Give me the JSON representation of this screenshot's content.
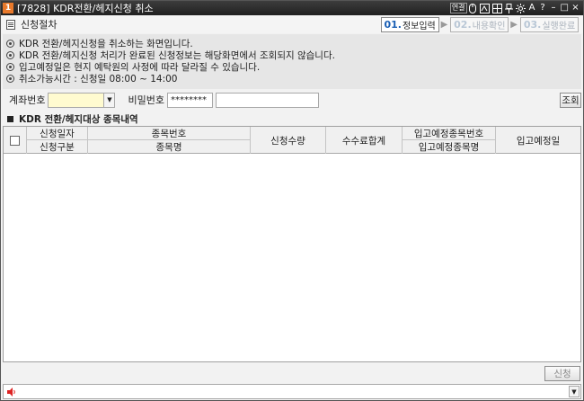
{
  "window": {
    "icon_label": "1",
    "title": "[7828] KDR전환/헤지신청 취소",
    "toolbar_icons": [
      "link-icon",
      "mouse-icon",
      "screenshot-icon",
      "grid-icon",
      "pin-icon",
      "settings-icon",
      "font-icon",
      "help-icon",
      "minimize-icon",
      "maximize-icon",
      "close-icon"
    ],
    "toolbar_labels": {
      "link": "연결",
      "font": "A",
      "help": "?",
      "minimize": "–",
      "maximize": "□",
      "close": "×"
    }
  },
  "steps": {
    "title": "신청절차",
    "items": [
      {
        "num": "01.",
        "label": "정보입력",
        "state": "active"
      },
      {
        "num": "02.",
        "label": "내용확인",
        "state": "dim"
      },
      {
        "num": "03.",
        "label": "실행완료",
        "state": "dim"
      }
    ],
    "arrow": "▶"
  },
  "notice": {
    "lines": [
      "KDR 전환/헤지신청을 취소하는 화면입니다.",
      "KDR 전환/헤지신청 처리가 완료된 신청정보는 해당화면에서 조회되지 않습니다.",
      "입고예정일은 현지 예탁원의 사정에 따라 달라질 수 있습니다.",
      "취소가능시간 : 신청일 08:00 ~ 14:00"
    ]
  },
  "account": {
    "account_label": "계좌번호",
    "account_value": "",
    "password_label": "비밀번호",
    "password_value": "********",
    "query_button": "조회"
  },
  "section": {
    "title": "KDR 전환/헤지대상 종목내역"
  },
  "grid": {
    "headers": {
      "apply_date": "신청일자",
      "apply_type": "신청구분",
      "stock_code": "종목번호",
      "stock_name": "종목명",
      "apply_qty": "신청수량",
      "fee_total": "수수료합계",
      "in_stock_code": "입고예정종목번호",
      "in_stock_name": "입고예정종목명",
      "in_date": "입고예정일"
    },
    "rows": []
  },
  "actions": {
    "submit_button": "신청"
  },
  "status": {
    "message": ""
  }
}
